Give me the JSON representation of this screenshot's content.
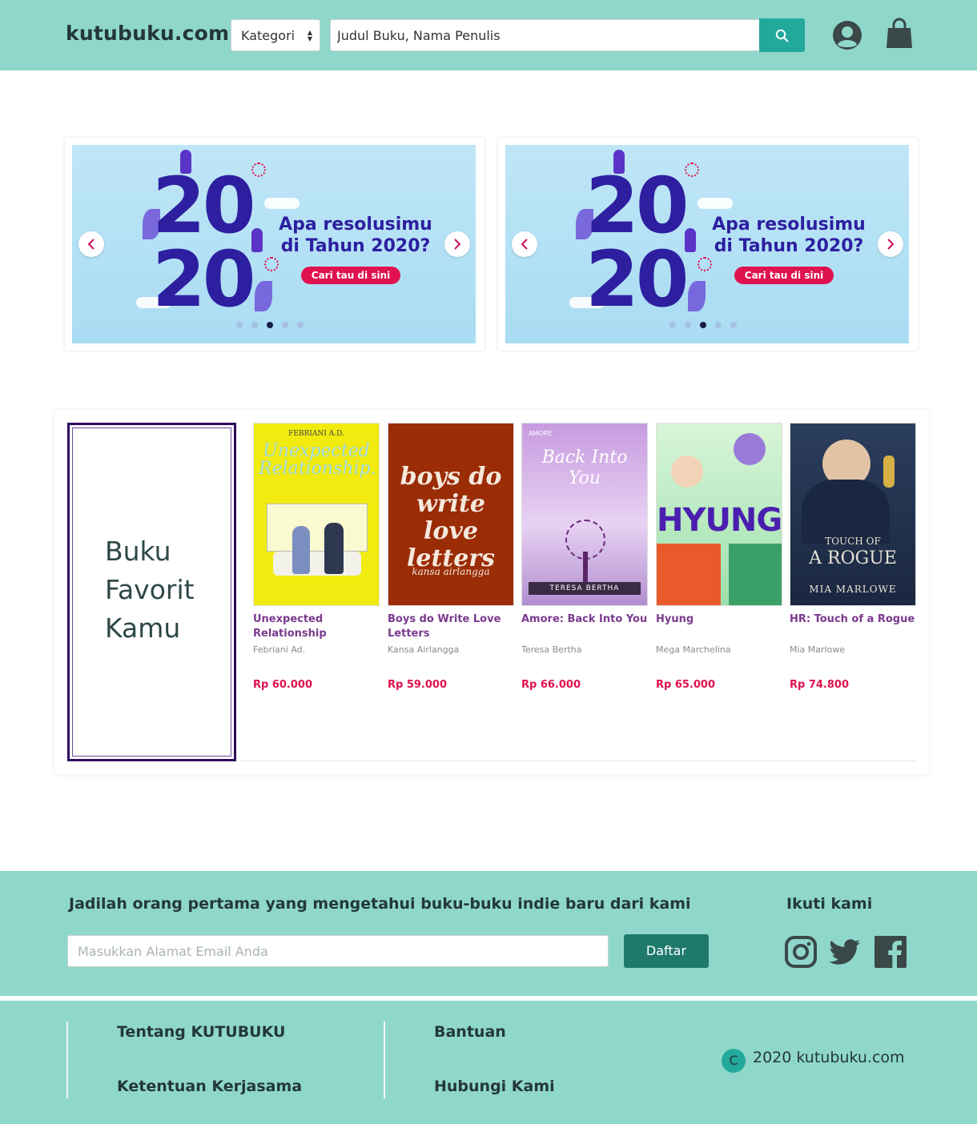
{
  "header": {
    "logo": "kutubuku.com",
    "category_select": "Kategori",
    "search_placeholder": "Judul Buku, Nama Penulis",
    "search_icon": "search-icon",
    "account_icon": "user-icon",
    "cart_icon": "shopping-bag-icon"
  },
  "banners": [
    {
      "big_top": "20",
      "big_bottom": "20",
      "headline": "Apa resolusimu di Tahun 2020?",
      "cta": "Cari tau di sini",
      "active_dot": 2,
      "dot_count": 5
    },
    {
      "big_top": "20",
      "big_bottom": "20",
      "headline": "Apa resolusimu di Tahun 2020?",
      "cta": "Cari tau di sini",
      "active_dot": 2,
      "dot_count": 5
    }
  ],
  "favorites": {
    "title": "Buku Favorit Kamu",
    "books": [
      {
        "title": "Unexpected Relationship",
        "author": "Febriani Ad.",
        "price": "Rp 60.000",
        "cover_author": "FEBRIANI A.D.",
        "cover_title": "Unexpected Relationship."
      },
      {
        "title": "Boys do Write Love Letters",
        "author": "Kansa Airlangga",
        "price": "Rp 59.000",
        "cover_title": "boys do write love letters",
        "cover_author": "kansa airlangga"
      },
      {
        "title": "Amore: Back Into You",
        "author": "Teresa Bertha",
        "price": "Rp 66.000",
        "cover_brand": "AMORE",
        "cover_title": "Back Into You",
        "cover_author": "TERESA BERTHA"
      },
      {
        "title": "Hyung",
        "author": "Mega Marchelina",
        "price": "Rp 65.000",
        "cover_title": "HYUNG"
      },
      {
        "title": "HR: Touch of a Rogue",
        "author": "Mia Marlowe",
        "price": "Rp 74.800",
        "cover_title_small": "TOUCH OF",
        "cover_title": "A ROGUE",
        "cover_author": "MIA MARLOWE"
      }
    ]
  },
  "newsletter": {
    "heading": "Jadilah orang pertama yang mengetahui buku-buku indie baru dari kami",
    "email_placeholder": "Masukkan Alamat Email Anda",
    "button": "Daftar",
    "follow_title": "Ikuti kami",
    "social": [
      "instagram-icon",
      "twitter-icon",
      "facebook-icon"
    ]
  },
  "footer": {
    "links_col1": [
      "Tentang KUTUBUKU",
      "Ketentuan Kerjasama"
    ],
    "links_col2": [
      "Bantuan",
      "Hubungi Kami"
    ],
    "copyright_symbol": "C",
    "copyright": "2020 kutubuku.com"
  },
  "colors": {
    "header_bg": "#8fd7cb",
    "accent": "#22a99b",
    "button_dark": "#1f7a6c",
    "price": "#e0124f",
    "book_title": "#7a3a8e",
    "panel_border": "#2e0a5c"
  }
}
